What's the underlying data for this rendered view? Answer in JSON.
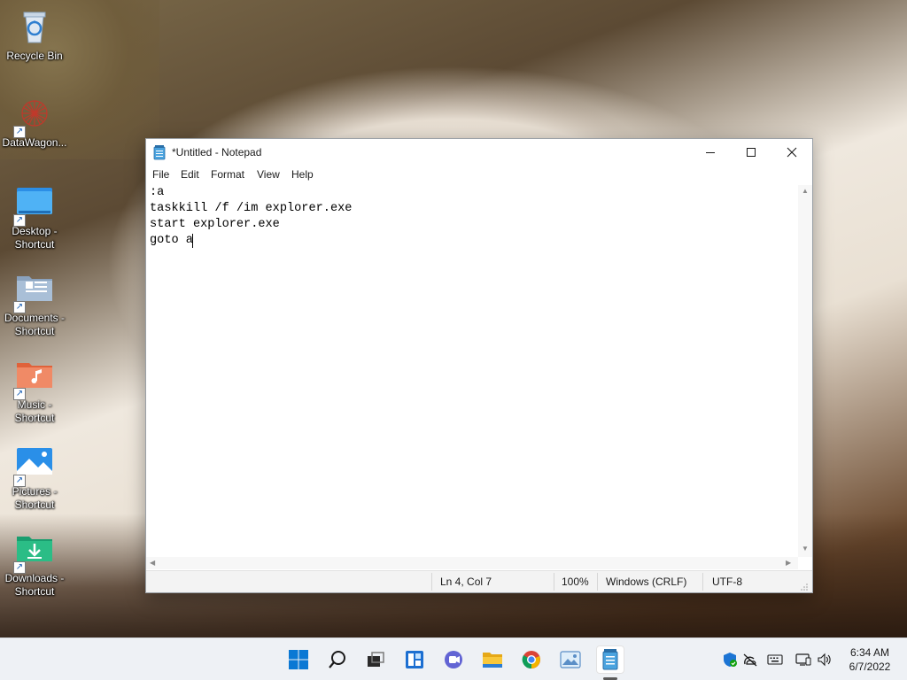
{
  "desktop": {
    "icons": [
      {
        "label": "Recycle Bin",
        "icon": "recycle-bin-icon",
        "shortcut": false
      },
      {
        "label": "DataWagon...",
        "icon": "datawagon-icon",
        "shortcut": true
      },
      {
        "label": "Desktop - Shortcut",
        "icon": "desktop-folder-icon",
        "shortcut": true
      },
      {
        "label": "Documents - Shortcut",
        "icon": "documents-folder-icon",
        "shortcut": true
      },
      {
        "label": "Music - Shortcut",
        "icon": "music-folder-icon",
        "shortcut": true
      },
      {
        "label": "Pictures - Shortcut",
        "icon": "pictures-folder-icon",
        "shortcut": true
      },
      {
        "label": "Downloads - Shortcut",
        "icon": "downloads-folder-icon",
        "shortcut": true
      }
    ]
  },
  "notepad": {
    "title": "*Untitled - Notepad",
    "menu": [
      "File",
      "Edit",
      "Format",
      "View",
      "Help"
    ],
    "content": ":a\ntaskkill /f /im explorer.exe\nstart explorer.exe\ngoto a",
    "status": {
      "position": "Ln 4, Col 7",
      "zoom": "100%",
      "line_ending": "Windows (CRLF)",
      "encoding": "UTF-8"
    }
  },
  "taskbar": {
    "apps": [
      "start-icon",
      "search-icon",
      "task-view-icon",
      "widgets-icon",
      "teams-chat-icon",
      "file-explorer-icon",
      "chrome-icon",
      "photos-icon",
      "notepad-icon"
    ],
    "active_app": "notepad-icon",
    "tray": [
      "security-icon",
      "network-icon",
      "keyboard-icon",
      "display-icon",
      "volume-icon"
    ],
    "time": "6:34 AM",
    "date": "6/7/2022"
  },
  "colors": {
    "accent": "#0067c0",
    "taskbar_bg": "#eef1f5",
    "window_bg": "#ffffff",
    "statusbar_bg": "#f3f3f3"
  }
}
